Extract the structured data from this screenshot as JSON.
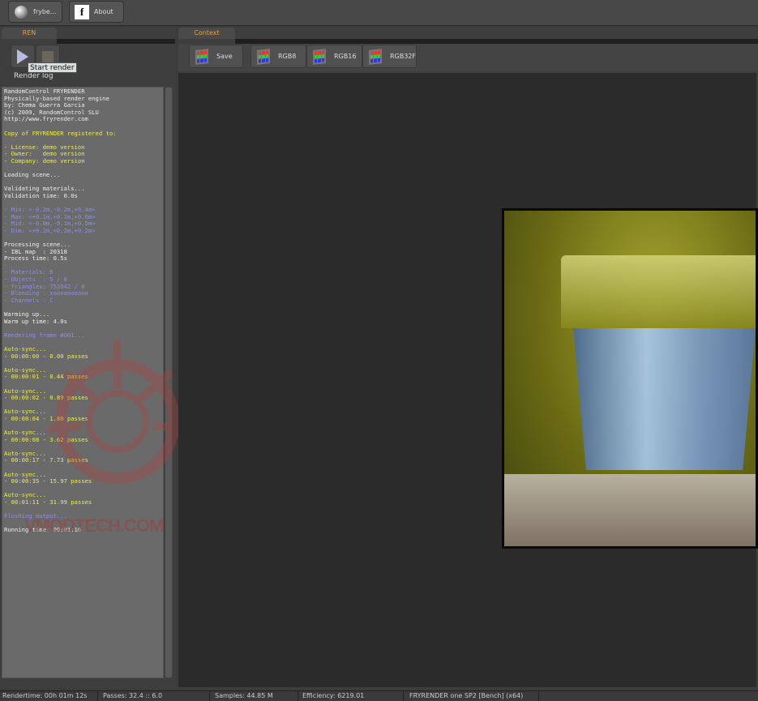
{
  "topbar": {
    "buttons": [
      {
        "label": "frybe...",
        "icon": "globe-icon"
      },
      {
        "label": "About",
        "icon": "facebook-icon"
      }
    ]
  },
  "left": {
    "tab": "REN",
    "tooltip": "Start render",
    "log_label": "Render log",
    "log": [
      {
        "t": "RandomControl FRYRENDER",
        "c": "w"
      },
      {
        "t": "Physically-based render engine",
        "c": "w"
      },
      {
        "t": "by: Chema Guerra Garcia",
        "c": "w"
      },
      {
        "t": "(c) 2009, RandomControl SLU",
        "c": "w"
      },
      {
        "t": "http://www.fryrender.com",
        "c": "w"
      },
      {
        "t": "",
        "c": "w"
      },
      {
        "t": "Copy of FRYRENDER registered to:",
        "c": "y"
      },
      {
        "t": "",
        "c": "w"
      },
      {
        "t": "- License: demo version",
        "c": "y"
      },
      {
        "t": "- Owner:   demo version",
        "c": "y"
      },
      {
        "t": "- Company: demo version",
        "c": "y"
      },
      {
        "t": "",
        "c": "w"
      },
      {
        "t": "Loading scene...",
        "c": "w"
      },
      {
        "t": "",
        "c": "w"
      },
      {
        "t": "Validating materials...",
        "c": "w"
      },
      {
        "t": "Validation time: 0.0s",
        "c": "w"
      },
      {
        "t": "",
        "c": "w"
      },
      {
        "t": "- Min: <-0.2m,-0.2m,+0.4m>",
        "c": "b"
      },
      {
        "t": "- Max: <+0.1m,+0.1m,+0.6m>",
        "c": "b"
      },
      {
        "t": "- Mid: <-0.0m,-0.1m,+0.5m>",
        "c": "b"
      },
      {
        "t": "- Dim: <+0.2m,+0.2m,+0.2m>",
        "c": "b"
      },
      {
        "t": "",
        "c": "w"
      },
      {
        "t": "Processing scene...",
        "c": "w"
      },
      {
        "t": "- IBL map  : 20318",
        "c": "w"
      },
      {
        "t": "Process time: 0.5s",
        "c": "w"
      },
      {
        "t": "",
        "c": "w"
      },
      {
        "t": "- Materials: 6",
        "c": "b"
      },
      {
        "t": "- Objects  : 5 / 0",
        "c": "b"
      },
      {
        "t": "- Triangles: 752642 / 0",
        "c": "b"
      },
      {
        "t": "- Blending : xoooooooooo",
        "c": "b"
      },
      {
        "t": "- Channels : C",
        "c": "b"
      },
      {
        "t": "",
        "c": "w"
      },
      {
        "t": "Warming up...",
        "c": "w"
      },
      {
        "t": "Warm up time: 4.0s",
        "c": "w"
      },
      {
        "t": "",
        "c": "w"
      },
      {
        "t": "Rendering frame #001...",
        "c": "b"
      },
      {
        "t": "",
        "c": "w"
      },
      {
        "t": "Auto-sync...",
        "c": "y"
      },
      {
        "t": "- 00:00:00 - 0.00 passes",
        "c": "y"
      },
      {
        "t": "",
        "c": "w"
      },
      {
        "t": "Auto-sync...",
        "c": "y"
      },
      {
        "t": "- 00:00:01 - 0.44 passes",
        "c": "y"
      },
      {
        "t": "",
        "c": "w"
      },
      {
        "t": "Auto-sync...",
        "c": "y"
      },
      {
        "t": "- 00:00:02 - 0.89 passes",
        "c": "y"
      },
      {
        "t": "",
        "c": "w"
      },
      {
        "t": "Auto-sync...",
        "c": "y"
      },
      {
        "t": "- 00:00:04 - 1.80 passes",
        "c": "y"
      },
      {
        "t": "",
        "c": "w"
      },
      {
        "t": "Auto-sync...",
        "c": "y"
      },
      {
        "t": "- 00:00:08 - 3.62 passes",
        "c": "y"
      },
      {
        "t": "",
        "c": "w"
      },
      {
        "t": "Auto-sync...",
        "c": "y"
      },
      {
        "t": "- 00:00:17 - 7.73 passes",
        "c": "y"
      },
      {
        "t": "",
        "c": "w"
      },
      {
        "t": "Auto-sync...",
        "c": "y"
      },
      {
        "t": "- 00:00:35 - 15.97 passes",
        "c": "y"
      },
      {
        "t": "",
        "c": "w"
      },
      {
        "t": "Auto-sync...",
        "c": "y"
      },
      {
        "t": "- 00:01:11 - 31.99 passes",
        "c": "y"
      },
      {
        "t": "",
        "c": "w"
      },
      {
        "t": "Flushing output...",
        "c": "b"
      },
      {
        "t": "",
        "c": "w"
      },
      {
        "t": "Running time: 00:01:16",
        "c": "w"
      }
    ],
    "watermark": "VMODTECH.COM"
  },
  "right": {
    "tab": "Context",
    "buttons": [
      "Save",
      "RGB8",
      "RGB16",
      "RGB32F"
    ]
  },
  "status": [
    "Rendertime: 00h 01m 12s",
    "Passes: 32.4 :: 6.0",
    "Samples: 44.85 M",
    "Efficiency: 6219.01",
    "FRYRENDER one SP2 [Bench] (x64)"
  ]
}
